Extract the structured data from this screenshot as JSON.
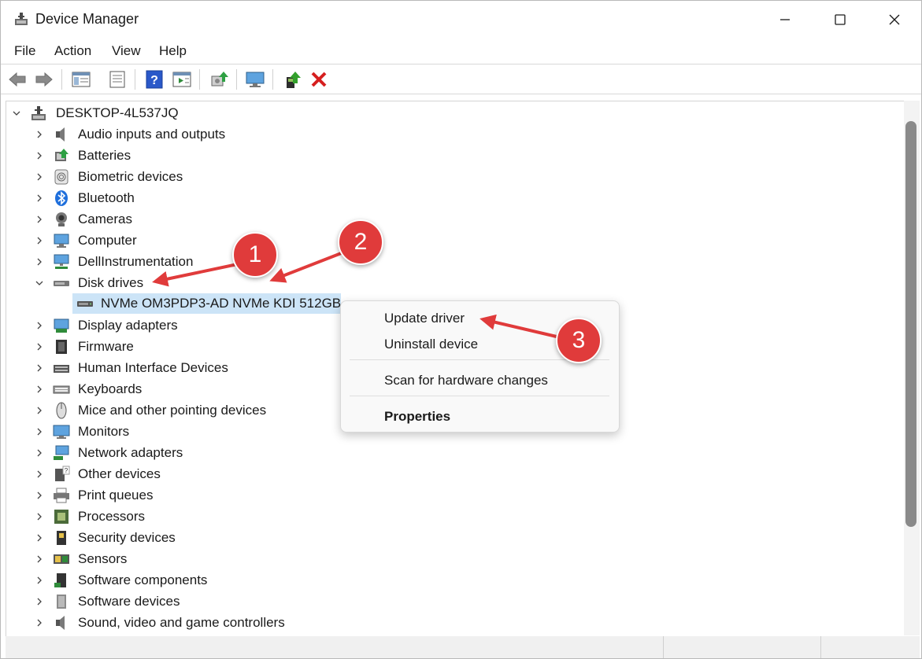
{
  "window": {
    "title": "Device Manager",
    "minimize_icon": "minimize-icon",
    "maximize_icon": "maximize-icon",
    "close_icon": "close-icon"
  },
  "menu": [
    "File",
    "Action",
    "View",
    "Help"
  ],
  "toolbar": {
    "icons": [
      "back-icon",
      "forward-icon",
      "show-hide-console-tree-icon",
      "properties-icon",
      "help-icon",
      "action-pane-icon",
      "scan-hardware-icon",
      "monitor-icon",
      "update-driver-icon",
      "uninstall-device-icon"
    ]
  },
  "tree": {
    "root": "DESKTOP-4L537JQ",
    "categories": [
      {
        "label": "Audio inputs and outputs",
        "icon": "speaker-icon"
      },
      {
        "label": "Batteries",
        "icon": "battery-icon"
      },
      {
        "label": "Biometric devices",
        "icon": "fingerprint-icon"
      },
      {
        "label": "Bluetooth",
        "icon": "bluetooth-icon"
      },
      {
        "label": "Cameras",
        "icon": "camera-icon"
      },
      {
        "label": "Computer",
        "icon": "computer-icon"
      },
      {
        "label": "DellInstrumentation",
        "icon": "network-computer-icon"
      },
      {
        "label": "Disk drives",
        "icon": "disk-drive-icon",
        "expanded": true,
        "children": [
          "NVMe OM3PDP3-AD NVMe KDI 512GB"
        ]
      },
      {
        "label": "Display adapters",
        "icon": "display-adapter-icon"
      },
      {
        "label": "Firmware",
        "icon": "chip-icon"
      },
      {
        "label": "Human Interface Devices",
        "icon": "hid-icon"
      },
      {
        "label": "Keyboards",
        "icon": "keyboard-icon"
      },
      {
        "label": "Mice and other pointing devices",
        "icon": "mouse-icon"
      },
      {
        "label": "Monitors",
        "icon": "monitor-icon"
      },
      {
        "label": "Network adapters",
        "icon": "network-adapter-icon"
      },
      {
        "label": "Other devices",
        "icon": "unknown-device-icon"
      },
      {
        "label": "Print queues",
        "icon": "printer-icon"
      },
      {
        "label": "Processors",
        "icon": "processor-icon"
      },
      {
        "label": "Security devices",
        "icon": "security-device-icon"
      },
      {
        "label": "Sensors",
        "icon": "sensor-icon"
      },
      {
        "label": "Software components",
        "icon": "software-component-icon"
      },
      {
        "label": "Software devices",
        "icon": "software-device-icon"
      },
      {
        "label": "Sound, video and game controllers",
        "icon": "speaker-icon"
      }
    ]
  },
  "context_menu": {
    "update_driver": "Update driver",
    "uninstall_device": "Uninstall device",
    "scan_hardware": "Scan for hardware changes",
    "properties": "Properties"
  },
  "annotations": {
    "badge1": "1",
    "badge2": "2",
    "badge3": "3"
  },
  "colors": {
    "selection": "#cce4f7",
    "badge": "#e03b3b",
    "arrow": "#e03b3b"
  }
}
